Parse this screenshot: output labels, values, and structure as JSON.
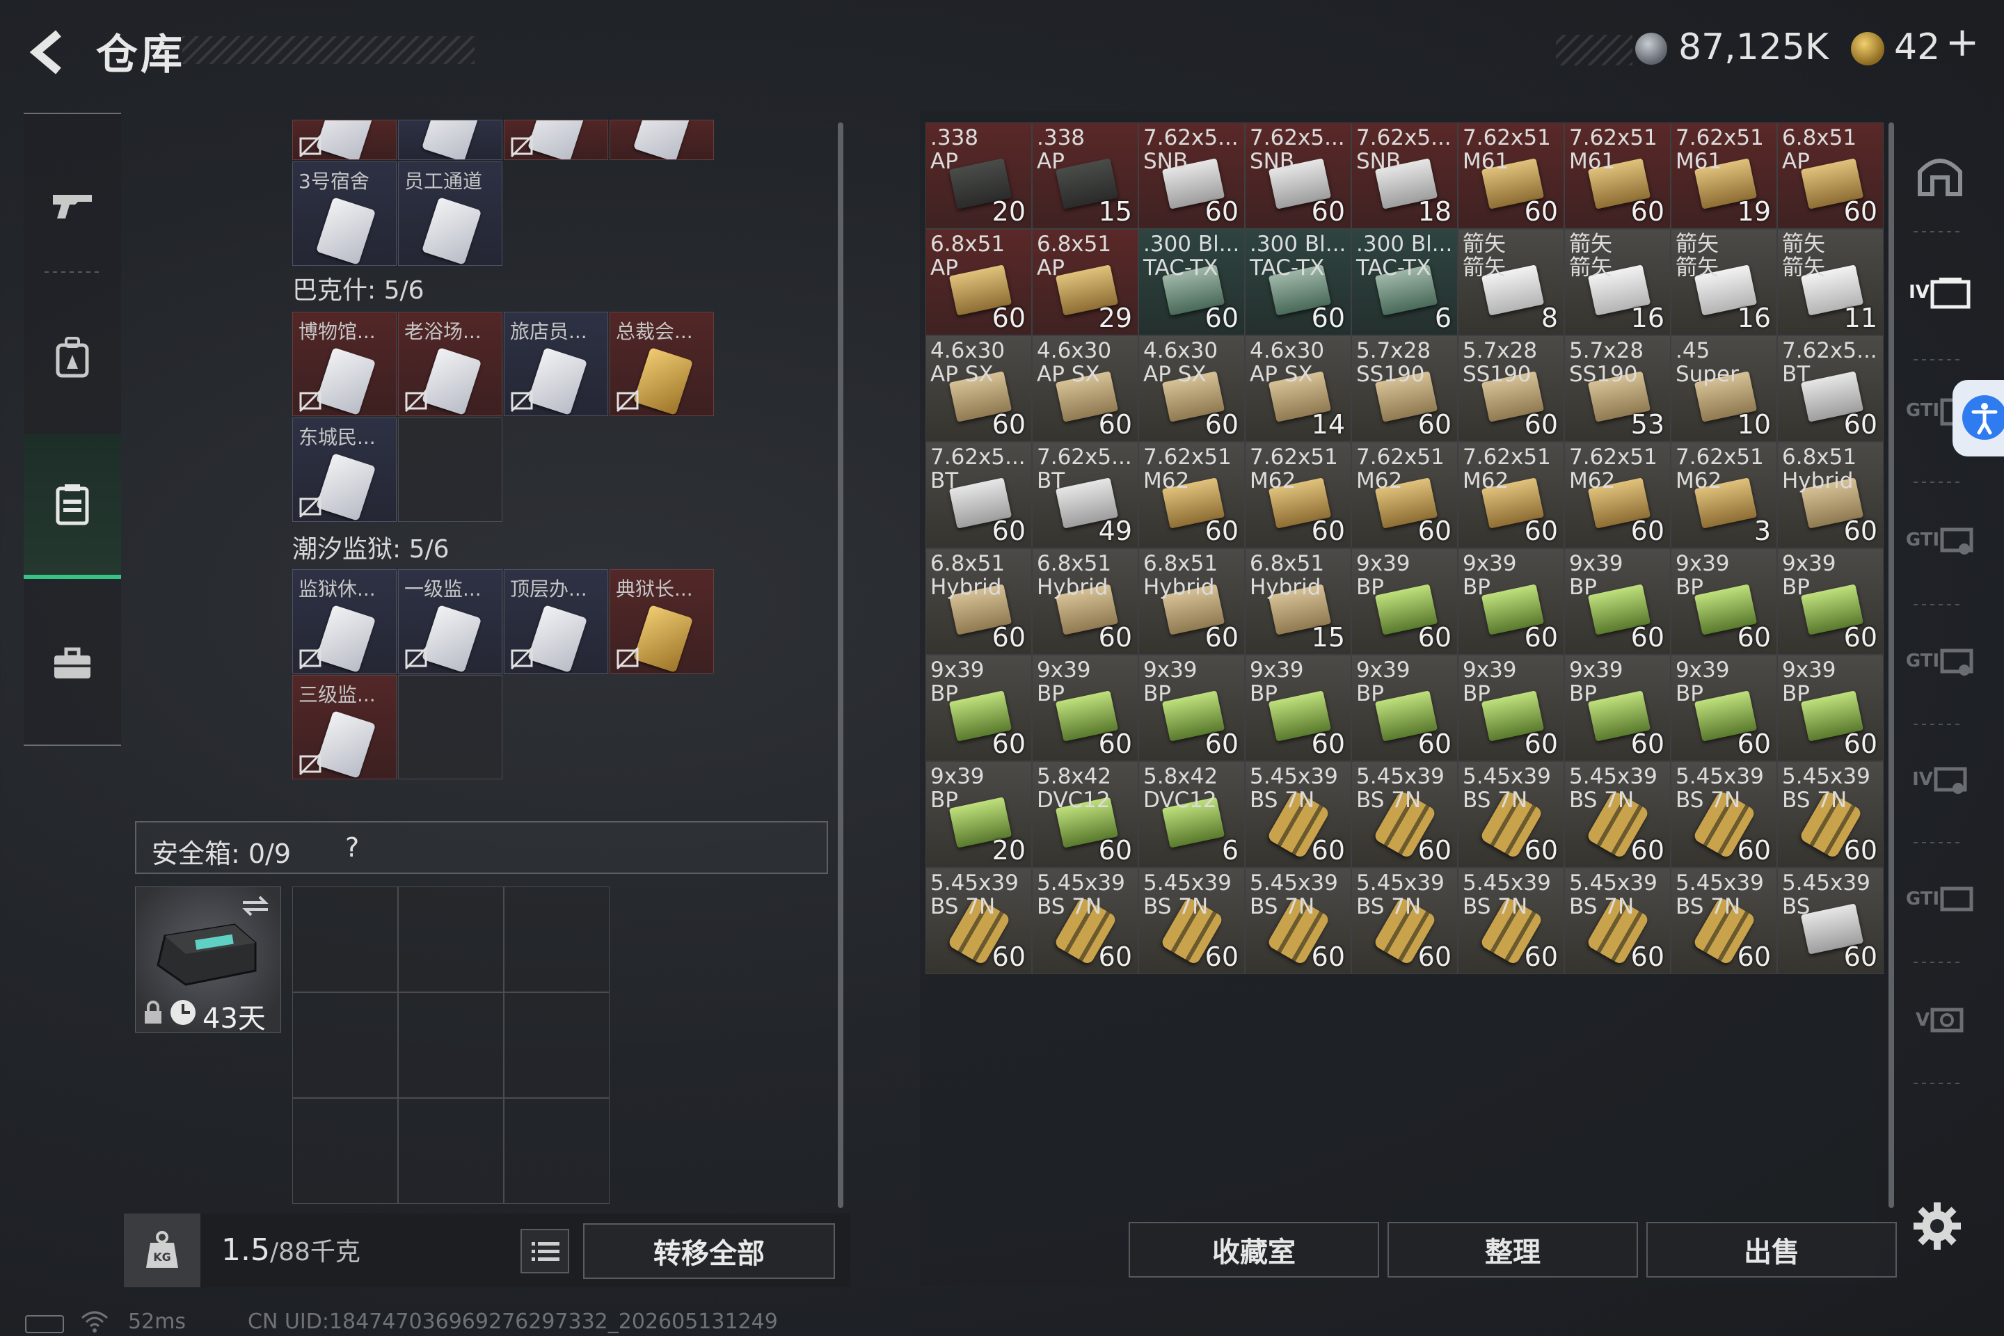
{
  "header": {
    "title": "仓库",
    "currency_silver": "87,125K",
    "currency_gold": "42",
    "add_label": "+"
  },
  "sidebar": {
    "items": [
      {
        "name": "weapon",
        "icon": "gun-icon"
      },
      {
        "name": "backpack",
        "icon": "backpack-icon"
      },
      {
        "name": "vest",
        "icon": "vest-icon",
        "active": true
      },
      {
        "name": "case",
        "icon": "briefcase-icon"
      }
    ]
  },
  "keys": {
    "top_row_cells": [
      "",
      "",
      "",
      ""
    ],
    "group0_cells": [
      "3号宿舍",
      "员工通道"
    ],
    "groups": [
      {
        "label": "巴克什: 5/6",
        "cells": [
          "博物馆...",
          "老浴场...",
          "旅店员...",
          "总裁会...",
          "东城民..."
        ]
      },
      {
        "label": "潮汐监狱: 5/6",
        "cells": [
          "监狱休...",
          "一级监...",
          "顶层办...",
          "典狱长...",
          "三级监..."
        ]
      }
    ]
  },
  "safe": {
    "label": "安全箱: 0/9",
    "help": "?",
    "item_days": "43天"
  },
  "bottom_left": {
    "weight_value": "1.5",
    "weight_max": "/88千克",
    "transfer_label": "转移全部"
  },
  "status": {
    "ping": "52ms",
    "uid": "CN UID:1847470369692762973​32_202605131249"
  },
  "ammo": {
    "cells": [
      {
        "name": ".338\nAP",
        "qty": "20",
        "bg": "red",
        "box": "dark"
      },
      {
        "name": ".338\nAP",
        "qty": "15",
        "bg": "red",
        "box": "dark"
      },
      {
        "name": "7.62x5...\nSNB",
        "qty": "60",
        "bg": "red",
        "box": "white"
      },
      {
        "name": "7.62x5...\nSNB",
        "qty": "60",
        "bg": "red",
        "box": "white"
      },
      {
        "name": "7.62x5...\nSNB",
        "qty": "18",
        "bg": "red",
        "box": "white"
      },
      {
        "name": "7.62x51\nM61",
        "qty": "60",
        "bg": "red",
        "box": "gold"
      },
      {
        "name": "7.62x51\nM61",
        "qty": "60",
        "bg": "red",
        "box": "gold"
      },
      {
        "name": "7.62x51\nM61",
        "qty": "19",
        "bg": "red",
        "box": "gold"
      },
      {
        "name": "6.8x51\nAP",
        "qty": "60",
        "bg": "red",
        "box": "gold"
      },
      {
        "name": "6.8x51\nAP",
        "qty": "60",
        "bg": "red",
        "box": "gold"
      },
      {
        "name": "6.8x51\nAP",
        "qty": "29",
        "bg": "red",
        "box": "gold"
      },
      {
        "name": ".300 Bl...\nTAC-TX",
        "qty": "60",
        "bg": "green",
        "box": "tac"
      },
      {
        "name": ".300 Bl...\nTAC-TX",
        "qty": "60",
        "bg": "green",
        "box": "tac"
      },
      {
        "name": ".300 Bl...\nTAC-TX",
        "qty": "6",
        "bg": "green",
        "box": "tac"
      },
      {
        "name": "箭矢\n箭矢",
        "qty": "8",
        "bg": "grey",
        "box": "arrow"
      },
      {
        "name": "箭矢\n箭矢",
        "qty": "16",
        "bg": "grey",
        "box": "arrow"
      },
      {
        "name": "箭矢\n箭矢",
        "qty": "16",
        "bg": "grey",
        "box": "arrow"
      },
      {
        "name": "箭矢\n箭矢",
        "qty": "11",
        "bg": "grey",
        "box": "arrow"
      },
      {
        "name": "4.6x30\nAP SX",
        "qty": "60",
        "bg": "grey",
        "box": "tan"
      },
      {
        "name": "4.6x30\nAP SX",
        "qty": "60",
        "bg": "grey",
        "box": "tan"
      },
      {
        "name": "4.6x30\nAP SX",
        "qty": "60",
        "bg": "grey",
        "box": "tan"
      },
      {
        "name": "4.6x30\nAP SX",
        "qty": "14",
        "bg": "grey",
        "box": "tan"
      },
      {
        "name": "5.7x28\nSS190",
        "qty": "60",
        "bg": "grey",
        "box": "tan"
      },
      {
        "name": "5.7x28\nSS190",
        "qty": "60",
        "bg": "grey",
        "box": "tan"
      },
      {
        "name": "5.7x28\nSS190",
        "qty": "53",
        "bg": "grey",
        "box": "tan"
      },
      {
        "name": ".45\nSuper",
        "qty": "10",
        "bg": "grey",
        "box": "tan"
      },
      {
        "name": "7.62x5...\nBT",
        "qty": "60",
        "bg": "grey",
        "box": "white"
      },
      {
        "name": "7.62x5...\nBT",
        "qty": "60",
        "bg": "grey",
        "box": "white"
      },
      {
        "name": "7.62x5...\nBT",
        "qty": "49",
        "bg": "grey",
        "box": "white"
      },
      {
        "name": "7.62x51\nM62",
        "qty": "60",
        "bg": "grey",
        "box": "gold"
      },
      {
        "name": "7.62x51\nM62",
        "qty": "60",
        "bg": "grey",
        "box": "gold"
      },
      {
        "name": "7.62x51\nM62",
        "qty": "60",
        "bg": "grey",
        "box": "gold"
      },
      {
        "name": "7.62x51\nM62",
        "qty": "60",
        "bg": "grey",
        "box": "gold"
      },
      {
        "name": "7.62x51\nM62",
        "qty": "60",
        "bg": "grey",
        "box": "gold"
      },
      {
        "name": "7.62x51\nM62",
        "qty": "3",
        "bg": "grey",
        "box": "gold"
      },
      {
        "name": "6.8x51\nHybrid",
        "qty": "60",
        "bg": "grey",
        "box": "tan"
      },
      {
        "name": "6.8x51\nHybrid",
        "qty": "60",
        "bg": "grey",
        "box": "tan"
      },
      {
        "name": "6.8x51\nHybrid",
        "qty": "60",
        "bg": "grey",
        "box": "tan"
      },
      {
        "name": "6.8x51\nHybrid",
        "qty": "60",
        "bg": "grey",
        "box": "tan"
      },
      {
        "name": "6.8x51\nHybrid",
        "qty": "15",
        "bg": "grey",
        "box": "tan"
      },
      {
        "name": "9x39\nBP",
        "qty": "60",
        "bg": "grey",
        "box": "green"
      },
      {
        "name": "9x39\nBP",
        "qty": "60",
        "bg": "grey",
        "box": "green"
      },
      {
        "name": "9x39\nBP",
        "qty": "60",
        "bg": "grey",
        "box": "green"
      },
      {
        "name": "9x39\nBP",
        "qty": "60",
        "bg": "grey",
        "box": "green"
      },
      {
        "name": "9x39\nBP",
        "qty": "60",
        "bg": "grey",
        "box": "green"
      },
      {
        "name": "9x39\nBP",
        "qty": "60",
        "bg": "grey",
        "box": "green"
      },
      {
        "name": "9x39\nBP",
        "qty": "60",
        "bg": "grey",
        "box": "green"
      },
      {
        "name": "9x39\nBP",
        "qty": "60",
        "bg": "grey",
        "box": "green"
      },
      {
        "name": "9x39\nBP",
        "qty": "60",
        "bg": "grey",
        "box": "green"
      },
      {
        "name": "9x39\nBP",
        "qty": "60",
        "bg": "grey",
        "box": "green"
      },
      {
        "name": "9x39\nBP",
        "qty": "60",
        "bg": "grey",
        "box": "green"
      },
      {
        "name": "9x39\nBP",
        "qty": "60",
        "bg": "grey",
        "box": "green"
      },
      {
        "name": "9x39\nBP",
        "qty": "60",
        "bg": "grey",
        "box": "green"
      },
      {
        "name": "9x39\nBP",
        "qty": "60",
        "bg": "grey",
        "box": "green"
      },
      {
        "name": "9x39\nBP",
        "qty": "20",
        "bg": "grey",
        "box": "green"
      },
      {
        "name": "5.8x42\nDVC12",
        "qty": "60",
        "bg": "grey",
        "box": "green"
      },
      {
        "name": "5.8x42\nDVC12",
        "qty": "6",
        "bg": "grey",
        "box": "green"
      },
      {
        "name": "5.45x39\nBS 7N",
        "qty": "60",
        "bg": "grey",
        "box": "bullets"
      },
      {
        "name": "5.45x39\nBS 7N",
        "qty": "60",
        "bg": "grey",
        "box": "bullets"
      },
      {
        "name": "5.45x39\nBS 7N",
        "qty": "60",
        "bg": "grey",
        "box": "bullets"
      },
      {
        "name": "5.45x39\nBS 7N",
        "qty": "60",
        "bg": "grey",
        "box": "bullets"
      },
      {
        "name": "5.45x39\nBS 7N",
        "qty": "60",
        "bg": "grey",
        "box": "bullets"
      },
      {
        "name": "5.45x39\nBS 7N",
        "qty": "60",
        "bg": "grey",
        "box": "bullets"
      },
      {
        "name": "5.45x39\nBS 7N",
        "qty": "60",
        "bg": "grey",
        "box": "bullets"
      },
      {
        "name": "5.45x39\nBS 7N",
        "qty": "60",
        "bg": "grey",
        "box": "bullets"
      },
      {
        "name": "5.45x39\nBS 7N",
        "qty": "60",
        "bg": "grey",
        "box": "bullets"
      },
      {
        "name": "5.45x39\nBS 7N",
        "qty": "60",
        "bg": "grey",
        "box": "bullets"
      },
      {
        "name": "5.45x39\nBS 7N",
        "qty": "60",
        "bg": "grey",
        "box": "bullets"
      },
      {
        "name": "5.45x39\nBS 7N",
        "qty": "60",
        "bg": "grey",
        "box": "bullets"
      },
      {
        "name": "5.45x39\nBS 7N",
        "qty": "60",
        "bg": "grey",
        "box": "bullets"
      },
      {
        "name": "5.45x39\nBS 7N",
        "qty": "60",
        "bg": "grey",
        "box": "bullets"
      },
      {
        "name": "5.45x39\nBS",
        "qty": "60",
        "bg": "grey",
        "box": "white"
      }
    ]
  },
  "right_tabs": [
    {
      "name": "warehouse-tab",
      "label": "",
      "icon": "house-icon"
    },
    {
      "name": "depot-tab-1",
      "label": "IV",
      "icon": "depot-icon"
    },
    {
      "name": "depot-tab-2",
      "label": "GTI",
      "icon": "depot-icon"
    },
    {
      "name": "depot-tab-3",
      "label": "GTI",
      "icon": "depot-icon"
    },
    {
      "name": "depot-tab-4",
      "label": "GTI",
      "icon": "depot-icon"
    },
    {
      "name": "depot-tab-5",
      "label": "IV",
      "icon": "depot-icon"
    },
    {
      "name": "depot-tab-6",
      "label": "GTI",
      "icon": "depot-icon"
    },
    {
      "name": "depot-tab-7",
      "label": "V",
      "icon": "depot-icon"
    }
  ],
  "bottom_right": {
    "collection_label": "收藏室",
    "sort_label": "整理",
    "sell_label": "出售"
  },
  "colors": {
    "accent_green": "#35c486",
    "accessibility_blue": "#2f7bf0"
  }
}
